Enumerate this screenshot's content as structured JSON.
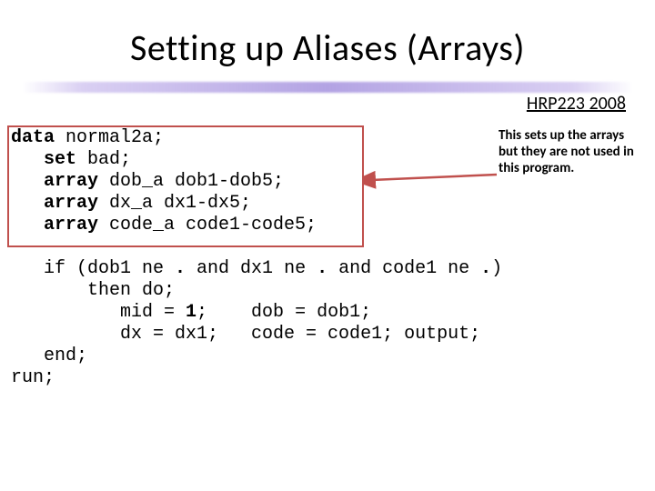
{
  "title": "Setting up Aliases (Arrays)",
  "header_label": "HRP223 2008",
  "annotation": "This sets up the arrays but they are not used in this program.",
  "code": {
    "l1a": "data",
    "l1b": " normal2a;",
    "l2a": "   set",
    "l2b": " bad;",
    "l3a": "   array",
    "l3b": " dob_a dob1-dob5;",
    "l4a": "   array",
    "l4b": " dx_a dx1-dx5;",
    "l5a": "   array",
    "l5b": " code_a code1-code5;",
    "blank1": " ",
    "l6a": "   if (dob1 ne ",
    "l6b": ".",
    "l6c": " and dx1 ne ",
    "l6d": ".",
    "l6e": " and code1 ne ",
    "l6f": ".",
    "l6g": ")",
    "l7": "       then do;",
    "l8a": "          mid = ",
    "l8b": "1",
    "l8c": ";    dob = dob1;",
    "l9": "          dx = dx1;   code = code1; output;",
    "l10": "   end;",
    "l11": "run;"
  }
}
